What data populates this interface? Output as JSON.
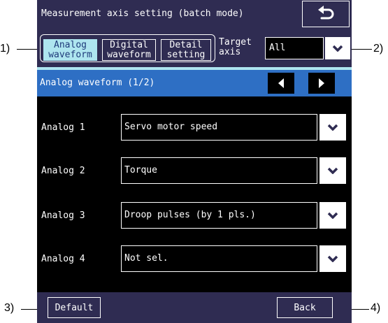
{
  "callouts": [
    "1)",
    "2)",
    "3)",
    "4)"
  ],
  "screen": {
    "title": "Measurement axis setting (batch mode)",
    "return_icon": "return-arrow-icon",
    "tabs": [
      {
        "label": "Analog\nwaveform",
        "active": true
      },
      {
        "label": "Digital\nwaveform",
        "active": false
      },
      {
        "label": "Detail\nsetting",
        "active": false
      }
    ],
    "target_axis": {
      "label": "Target\naxis",
      "value": "All"
    },
    "section": {
      "title": "Analog waveform (1/2)"
    },
    "rows": [
      {
        "label": "Analog 1",
        "value": "Servo motor speed"
      },
      {
        "label": "Analog 2",
        "value": "Torque"
      },
      {
        "label": "Analog 3",
        "value": "Droop pulses (by 1 pls.)"
      },
      {
        "label": "Analog 4",
        "value": "Not sel."
      }
    ],
    "footer": {
      "default_label": "Default",
      "back_label": "Back"
    }
  },
  "colors": {
    "bar_bg": "#2f2c52",
    "tab_active_bg": "#aee5ef",
    "tab_active_text": "#1e3a7a",
    "section_bg": "#2e6fc4",
    "screen_bg": "#000000",
    "text": "#ffffff"
  }
}
